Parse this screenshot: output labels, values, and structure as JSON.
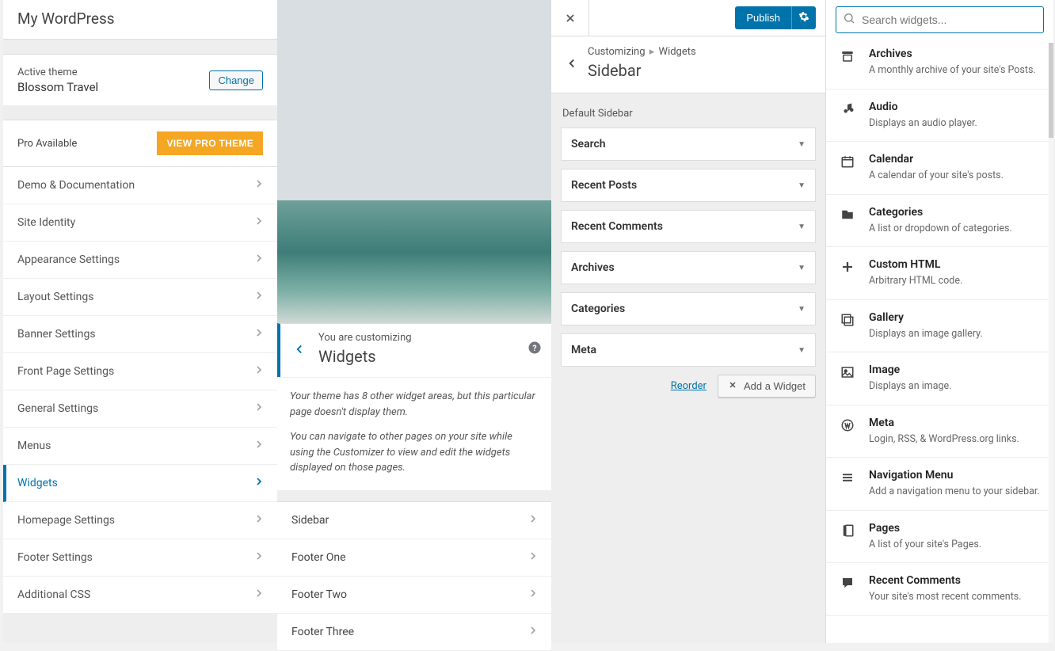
{
  "header": {
    "site_title": "My WordPress"
  },
  "theme": {
    "active_label": "Active theme",
    "name": "Blossom Travel",
    "change_label": "Change"
  },
  "pro": {
    "label": "Pro Available",
    "button": "VIEW PRO THEME"
  },
  "menu": [
    "Demo & Documentation",
    "Site Identity",
    "Appearance Settings",
    "Layout Settings",
    "Banner Settings",
    "Front Page Settings",
    "General Settings",
    "Menus",
    "Widgets",
    "Homepage Settings",
    "Footer Settings",
    "Additional CSS"
  ],
  "menu_active_index": 8,
  "widgets_panel": {
    "crumb_small": "You are customizing",
    "crumb_big": "Widgets",
    "desc1": "Your theme has 8 other widget areas, but this particular page doesn't display them.",
    "desc2": "You can navigate to other pages on your site while using the Customizer to view and edit the widgets displayed on those pages.",
    "areas": [
      "Sidebar",
      "Footer One",
      "Footer Two",
      "Footer Three"
    ]
  },
  "sidebar_panel": {
    "publish": "Publish",
    "crumb_prefix": "Customizing",
    "crumb_parent": "Widgets",
    "title": "Sidebar",
    "section_label": "Default Sidebar",
    "widgets": [
      "Search",
      "Recent Posts",
      "Recent Comments",
      "Archives",
      "Categories",
      "Meta"
    ],
    "reorder": "Reorder",
    "add_label": "Add a Widget"
  },
  "library": {
    "search_placeholder": "Search widgets...",
    "items": [
      {
        "icon": "archive",
        "title": "Archives",
        "desc": "A monthly archive of your site's Posts."
      },
      {
        "icon": "audio",
        "title": "Audio",
        "desc": "Displays an audio player."
      },
      {
        "icon": "calendar",
        "title": "Calendar",
        "desc": "A calendar of your site's posts."
      },
      {
        "icon": "categories",
        "title": "Categories",
        "desc": "A list or dropdown of categories."
      },
      {
        "icon": "plus",
        "title": "Custom HTML",
        "desc": "Arbitrary HTML code."
      },
      {
        "icon": "gallery",
        "title": "Gallery",
        "desc": "Displays an image gallery."
      },
      {
        "icon": "image",
        "title": "Image",
        "desc": "Displays an image."
      },
      {
        "icon": "meta",
        "title": "Meta",
        "desc": "Login, RSS, & WordPress.org links."
      },
      {
        "icon": "navmenu",
        "title": "Navigation Menu",
        "desc": "Add a navigation menu to your sidebar."
      },
      {
        "icon": "pages",
        "title": "Pages",
        "desc": "A list of your site's Pages."
      },
      {
        "icon": "comments",
        "title": "Recent Comments",
        "desc": "Your site's most recent comments."
      }
    ]
  }
}
